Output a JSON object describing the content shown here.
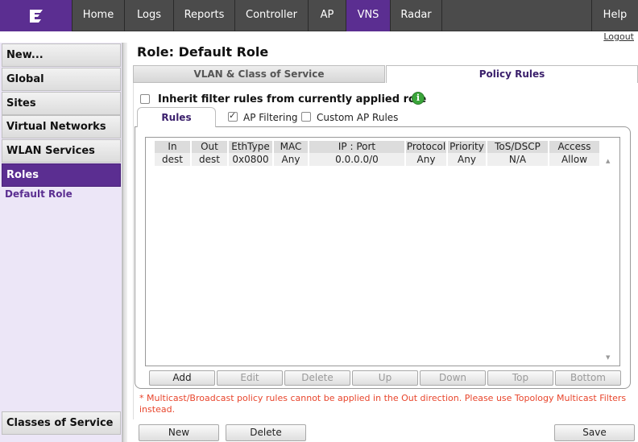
{
  "nav": {
    "logo_icon": "extreme-networks-logo",
    "tabs": [
      {
        "label": "Home"
      },
      {
        "label": "Logs"
      },
      {
        "label": "Reports"
      },
      {
        "label": "Controller"
      },
      {
        "label": "AP"
      },
      {
        "label": "VNS"
      },
      {
        "label": "Radar"
      },
      {
        "label": "Help"
      }
    ],
    "active_tab": "VNS",
    "logout": "Logout"
  },
  "sidebar": {
    "items": [
      {
        "label": "New..."
      },
      {
        "label": "Global"
      },
      {
        "label": "Sites"
      },
      {
        "label": "Virtual Networks"
      },
      {
        "label": "WLAN Services"
      },
      {
        "label": "Roles"
      }
    ],
    "sub_item": "Default Role",
    "bottom_item": "Classes of Service"
  },
  "main": {
    "title": "Role: Default Role",
    "tabs": [
      {
        "label": "VLAN & Class of Service"
      },
      {
        "label": "Policy Rules"
      }
    ],
    "inherit_label": "Inherit filter rules from currently applied role",
    "inherit_checked": false,
    "subtab": "Rules",
    "ap_filtering_label": "AP Filtering",
    "ap_filtering_checked": true,
    "custom_ap_rules_label": "Custom AP Rules",
    "custom_ap_rules_checked": false
  },
  "table": {
    "columns": [
      "In",
      "Out",
      "EthType",
      "MAC",
      "IP : Port",
      "Protocol",
      "Priority",
      "ToS/DSCP",
      "Access"
    ],
    "rows": [
      [
        "dest",
        "dest",
        "0x0800",
        "Any",
        "0.0.0.0/0",
        "Any",
        "Any",
        "N/A",
        "Allow"
      ]
    ]
  },
  "table_buttons": {
    "add": "Add",
    "edit": "Edit",
    "delete": "Delete",
    "up": "Up",
    "down": "Down",
    "top": "Top",
    "bottom": "Bottom"
  },
  "warning": "* Multicast/Broadcast policy rules cannot be applied in the Out direction. Please use Topology Multicast Filters instead.",
  "footer_buttons": {
    "new": "New",
    "delete": "Delete",
    "save": "Save"
  },
  "colors": {
    "accent": "#5b2e91",
    "nav_bg": "#4b4b4b",
    "warning": "#e8452c"
  }
}
